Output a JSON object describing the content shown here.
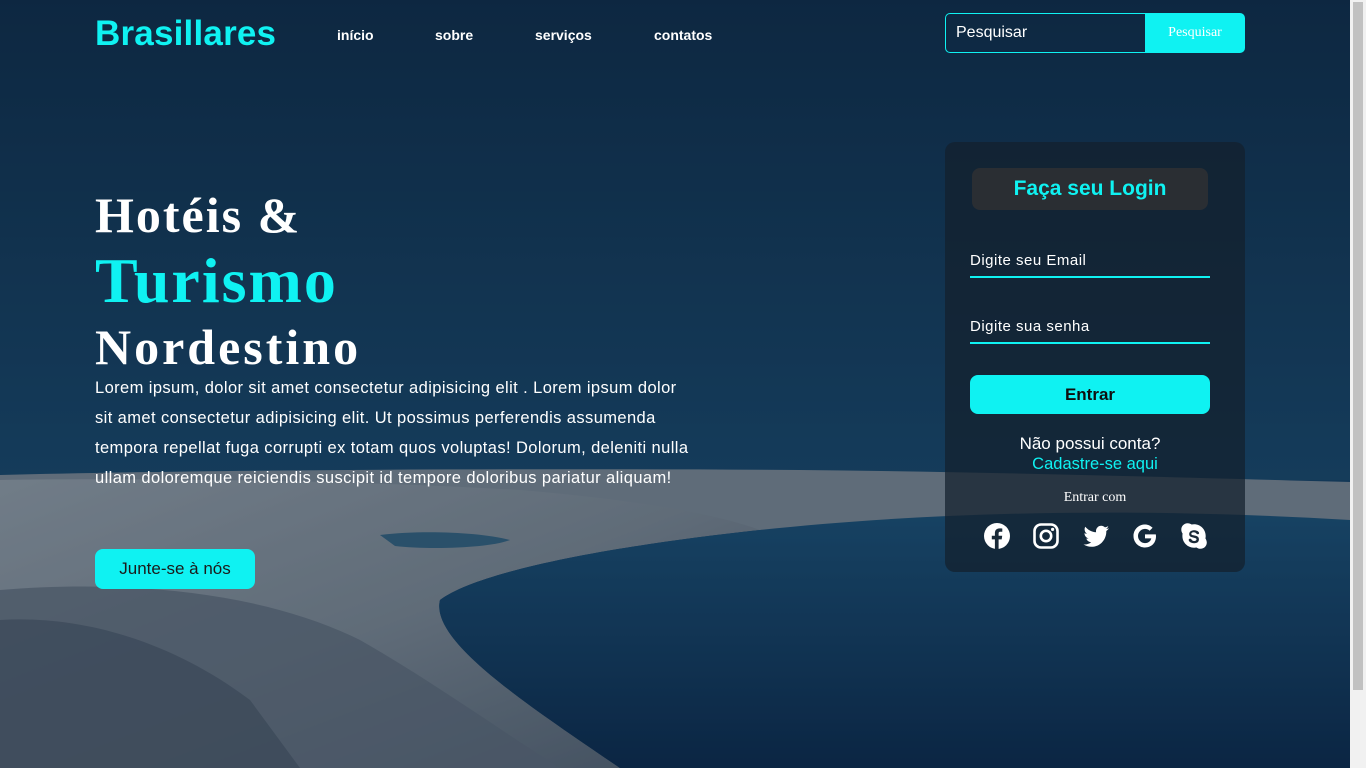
{
  "header": {
    "logo": "Brasillares",
    "nav": [
      "início",
      "sobre",
      "serviços",
      "contatos"
    ],
    "search": {
      "placeholder": "Pesquisar",
      "button_label": "Pesquisar"
    }
  },
  "hero": {
    "line1": "Hotéis &",
    "line2": "Turismo",
    "line3": "Nordestino",
    "text": "Lorem ipsum, dolor sit amet consectetur adipisicing elit . Lorem ipsum dolor sit amet consectetur adipisicing elit. Ut possimus perferendis assumenda tempora repellat fuga corrupti ex totam quos voluptas! Dolorum, deleniti nulla ullam doloremque reiciendis suscipit id tempore doloribus pariatur aliquam!",
    "cta": "Junte-se à nós"
  },
  "login": {
    "title": "Faça seu Login",
    "email_placeholder": "Digite seu Email",
    "password_placeholder": "Digite sua senha",
    "submit": "Entrar",
    "no_account": "Não possui conta?",
    "signup": "Cadastre-se aqui",
    "enter_with": "Entrar com",
    "socials": [
      "facebook-icon",
      "instagram-icon",
      "twitter-icon",
      "google-icon",
      "skype-icon"
    ]
  },
  "colors": {
    "accent": "#0ff2f2",
    "text": "#ffffff",
    "card": "#14202d"
  }
}
